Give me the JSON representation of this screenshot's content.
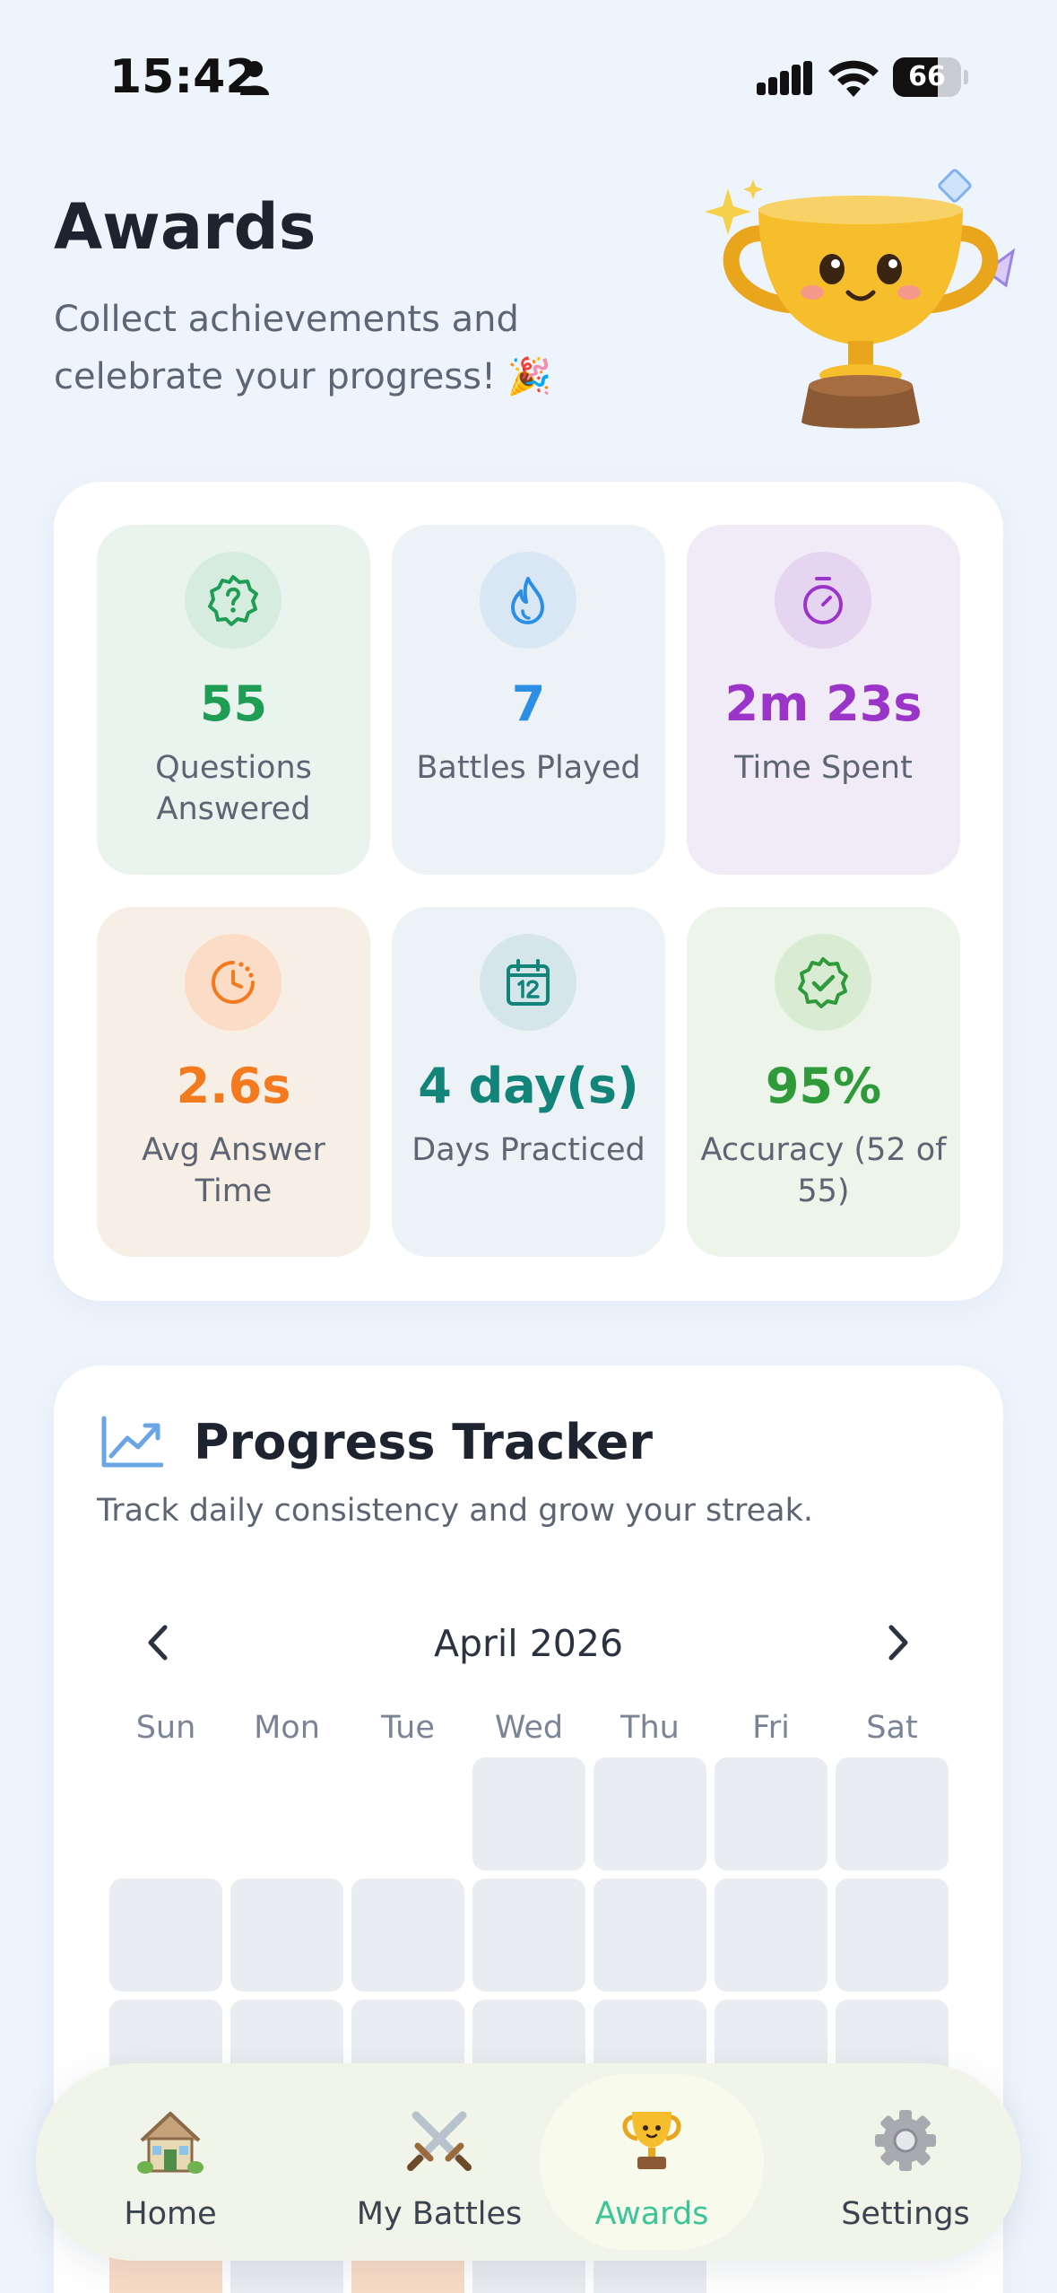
{
  "status_bar": {
    "time": "15:42",
    "battery": "66",
    "battery_level": 0.66
  },
  "header": {
    "title": "Awards",
    "subtitle": "Collect achievements and celebrate your progress! 🎉"
  },
  "stats": [
    {
      "value": "55",
      "label": "Questions Answered",
      "icon": "question-badge-icon",
      "color": "#1f9d55",
      "bg": "#eaf4ee",
      "circle": "#d5ecdf"
    },
    {
      "value": "7",
      "label": "Battles Played",
      "icon": "flame-icon",
      "color": "#2b8fe6",
      "bg": "#edf2f7",
      "circle": "#d9e6f3"
    },
    {
      "value": "2m 23s",
      "label": "Time Spent",
      "icon": "stopwatch-icon",
      "color": "#9b35c9",
      "bg": "#f1eaf7",
      "circle": "#e6d5f1"
    },
    {
      "value": "2.6s",
      "label": "Avg Answer Time",
      "icon": "clock-icon",
      "color": "#f47a1f",
      "bg": "#f7efe6",
      "circle": "#fbdcc6"
    },
    {
      "value": "4 day(s)",
      "label": "Days Practiced",
      "icon": "calendar-icon",
      "color": "#13847a",
      "bg": "#edf2f6",
      "circle": "#d5e6ea"
    },
    {
      "value": "95%",
      "label": "Accuracy (52 of 55)",
      "icon": "check-badge-icon",
      "color": "#2e9a3a",
      "bg": "#edf4ea",
      "circle": "#d9ecd3"
    }
  ],
  "progress": {
    "title": "Progress Tracker",
    "subtitle": "Track daily consistency and grow your streak.",
    "month": "April 2026",
    "weekdays": [
      "Sun",
      "Mon",
      "Tue",
      "Wed",
      "Thu",
      "Fri",
      "Sat"
    ]
  },
  "nav": [
    {
      "label": "Home",
      "icon": "house-icon"
    },
    {
      "label": "My Battles",
      "icon": "crossed-swords-icon"
    },
    {
      "label": "Awards",
      "icon": "trophy-icon",
      "selected": true
    },
    {
      "label": "Settings",
      "icon": "gear-icon"
    }
  ],
  "colors": {
    "accent": "#3cc59a",
    "background": "#eef4fc"
  }
}
